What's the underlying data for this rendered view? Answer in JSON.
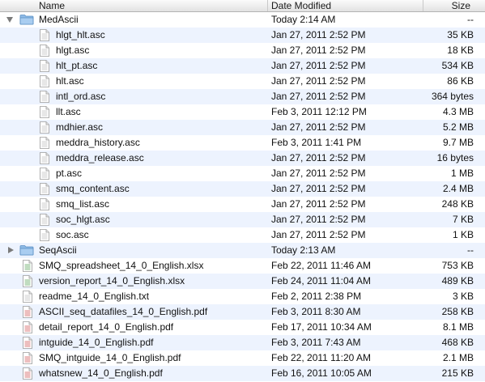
{
  "columns": {
    "name": "Name",
    "date": "Date Modified",
    "size": "Size"
  },
  "rows": [
    {
      "level": 0,
      "kind": "folder",
      "expanded": true,
      "name": "MedAscii",
      "date": "Today 2:14 AM",
      "size": "--",
      "icon": "folder-icon"
    },
    {
      "level": 1,
      "kind": "file",
      "name": "hlgt_hlt.asc",
      "date": "Jan 27, 2011 2:52 PM",
      "size": "35 KB",
      "icon": "document-icon"
    },
    {
      "level": 1,
      "kind": "file",
      "name": "hlgt.asc",
      "date": "Jan 27, 2011 2:52 PM",
      "size": "18 KB",
      "icon": "document-icon"
    },
    {
      "level": 1,
      "kind": "file",
      "name": "hlt_pt.asc",
      "date": "Jan 27, 2011 2:52 PM",
      "size": "534 KB",
      "icon": "document-icon"
    },
    {
      "level": 1,
      "kind": "file",
      "name": "hlt.asc",
      "date": "Jan 27, 2011 2:52 PM",
      "size": "86 KB",
      "icon": "document-icon"
    },
    {
      "level": 1,
      "kind": "file",
      "name": "intl_ord.asc",
      "date": "Jan 27, 2011 2:52 PM",
      "size": "364 bytes",
      "icon": "document-icon"
    },
    {
      "level": 1,
      "kind": "file",
      "name": "llt.asc",
      "date": "Feb 3, 2011 12:12 PM",
      "size": "4.3 MB",
      "icon": "document-icon"
    },
    {
      "level": 1,
      "kind": "file",
      "name": "mdhier.asc",
      "date": "Jan 27, 2011 2:52 PM",
      "size": "5.2 MB",
      "icon": "document-icon"
    },
    {
      "level": 1,
      "kind": "file",
      "name": "meddra_history.asc",
      "date": "Feb 3, 2011 1:41 PM",
      "size": "9.7 MB",
      "icon": "document-icon"
    },
    {
      "level": 1,
      "kind": "file",
      "name": "meddra_release.asc",
      "date": "Jan 27, 2011 2:52 PM",
      "size": "16 bytes",
      "icon": "document-icon"
    },
    {
      "level": 1,
      "kind": "file",
      "name": "pt.asc",
      "date": "Jan 27, 2011 2:52 PM",
      "size": "1 MB",
      "icon": "document-icon"
    },
    {
      "level": 1,
      "kind": "file",
      "name": "smq_content.asc",
      "date": "Jan 27, 2011 2:52 PM",
      "size": "2.4 MB",
      "icon": "document-icon"
    },
    {
      "level": 1,
      "kind": "file",
      "name": "smq_list.asc",
      "date": "Jan 27, 2011 2:52 PM",
      "size": "248 KB",
      "icon": "document-icon"
    },
    {
      "level": 1,
      "kind": "file",
      "name": "soc_hlgt.asc",
      "date": "Jan 27, 2011 2:52 PM",
      "size": "7 KB",
      "icon": "document-icon"
    },
    {
      "level": 1,
      "kind": "file",
      "name": "soc.asc",
      "date": "Jan 27, 2011 2:52 PM",
      "size": "1 KB",
      "icon": "document-icon"
    },
    {
      "level": 0,
      "kind": "folder",
      "expanded": false,
      "name": "SeqAscii",
      "date": "Today 2:13 AM",
      "size": "--",
      "icon": "folder-icon"
    },
    {
      "level": 0,
      "kind": "file",
      "name": "SMQ_spreadsheet_14_0_English.xlsx",
      "date": "Feb 22, 2011 11:46 AM",
      "size": "753 KB",
      "icon": "spreadsheet-icon"
    },
    {
      "level": 0,
      "kind": "file",
      "name": "version_report_14_0_English.xlsx",
      "date": "Feb 24, 2011 11:04 AM",
      "size": "489 KB",
      "icon": "spreadsheet-icon"
    },
    {
      "level": 0,
      "kind": "file",
      "name": "readme_14_0_English.txt",
      "date": "Feb 2, 2011 2:38 PM",
      "size": "3 KB",
      "icon": "text-document-icon"
    },
    {
      "level": 0,
      "kind": "file",
      "name": "ASCII_seq_datafiles_14_0_English.pdf",
      "date": "Feb 3, 2011 8:30 AM",
      "size": "258 KB",
      "icon": "pdf-document-icon"
    },
    {
      "level": 0,
      "kind": "file",
      "name": "detail_report_14_0_English.pdf",
      "date": "Feb 17, 2011 10:34 AM",
      "size": "8.1 MB",
      "icon": "pdf-document-icon"
    },
    {
      "level": 0,
      "kind": "file",
      "name": "intguide_14_0_English.pdf",
      "date": "Feb 3, 2011 7:43 AM",
      "size": "468 KB",
      "icon": "pdf-document-icon"
    },
    {
      "level": 0,
      "kind": "file",
      "name": "SMQ_intguide_14_0_English.pdf",
      "date": "Feb 22, 2011 11:20 AM",
      "size": "2.1 MB",
      "icon": "pdf-document-icon"
    },
    {
      "level": 0,
      "kind": "file",
      "name": "whatsnew_14_0_English.pdf",
      "date": "Feb 16, 2011 10:05 AM",
      "size": "215 KB",
      "icon": "pdf-document-icon"
    }
  ],
  "colors": {
    "stripe": "#edf3fe",
    "folder": "#6fa8dc",
    "triangle": "#7a7a7a"
  }
}
